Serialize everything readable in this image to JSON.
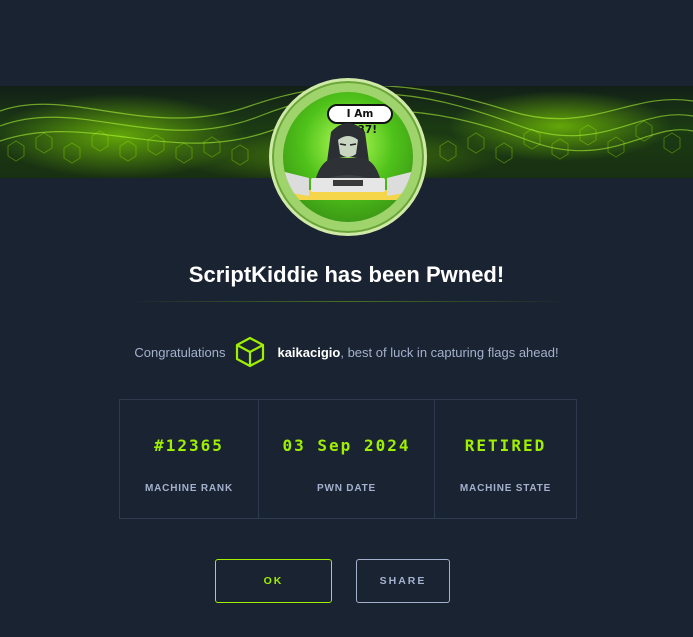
{
  "banner": {
    "accent": "#9fef00"
  },
  "avatar": {
    "bubble_text": "I Am 1337!"
  },
  "title": "ScriptKiddie has been Pwned!",
  "congrats": {
    "prefix": "Congratulations",
    "username": "kaikacigio",
    "suffix": ", best of luck in capturing flags ahead!"
  },
  "stats": [
    {
      "value": "#12365",
      "label": "MACHINE RANK"
    },
    {
      "value": "03 Sep 2024",
      "label": "PWN DATE"
    },
    {
      "value": "RETIRED",
      "label": "MACHINE STATE"
    }
  ],
  "buttons": {
    "ok": "OK",
    "share": "SHARE"
  },
  "colors": {
    "background": "#1a2332",
    "accent": "#9fef00",
    "muted": "#a4b1cd"
  }
}
